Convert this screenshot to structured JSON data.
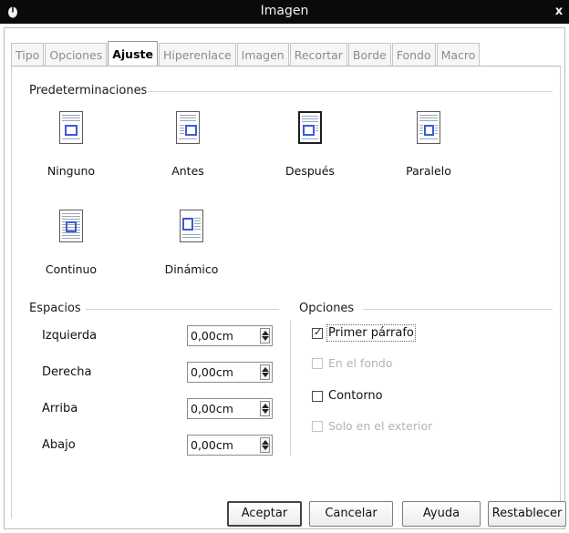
{
  "window": {
    "title": "Imagen",
    "close_label": "x"
  },
  "tabs": [
    {
      "label": "Tipo"
    },
    {
      "label": "Opciones"
    },
    {
      "label": "Ajuste",
      "active": true
    },
    {
      "label": "Hiperenlace"
    },
    {
      "label": "Imagen"
    },
    {
      "label": "Recortar"
    },
    {
      "label": "Borde"
    },
    {
      "label": "Fondo"
    },
    {
      "label": "Macro"
    }
  ],
  "presets": {
    "header": "Predeterminaciones",
    "items": [
      {
        "label": "Ninguno",
        "icon": "wrap-none-icon"
      },
      {
        "label": "Antes",
        "icon": "wrap-before-icon"
      },
      {
        "label": "Después",
        "icon": "wrap-after-icon",
        "selected": true
      },
      {
        "label": "Paralelo",
        "icon": "wrap-parallel-icon"
      },
      {
        "label": "Continuo",
        "icon": "wrap-through-icon"
      },
      {
        "label": "Dinámico",
        "icon": "wrap-optimal-icon"
      }
    ]
  },
  "spacing": {
    "header": "Espacios",
    "rows": [
      {
        "label": "Izquierda",
        "value": "0,00cm"
      },
      {
        "label": "Derecha",
        "value": "0,00cm"
      },
      {
        "label": "Arriba",
        "value": "0,00cm"
      },
      {
        "label": "Abajo",
        "value": "0,00cm"
      }
    ]
  },
  "options": {
    "header": "Opciones",
    "items": [
      {
        "label": "Primer párrafo",
        "checked": true,
        "enabled": true
      },
      {
        "label": "En el fondo",
        "checked": false,
        "enabled": false
      },
      {
        "label": "Contorno",
        "checked": false,
        "enabled": true
      },
      {
        "label": "Solo en el exterior",
        "checked": false,
        "enabled": false
      }
    ]
  },
  "buttons": {
    "ok": "Aceptar",
    "cancel": "Cancelar",
    "help": "Ayuda",
    "reset": "Restablecer"
  },
  "colors": {
    "titlebar": "#0a0a0a",
    "icon_accent": "#3b5bd6",
    "disabled_text": "#b4b4b4"
  }
}
